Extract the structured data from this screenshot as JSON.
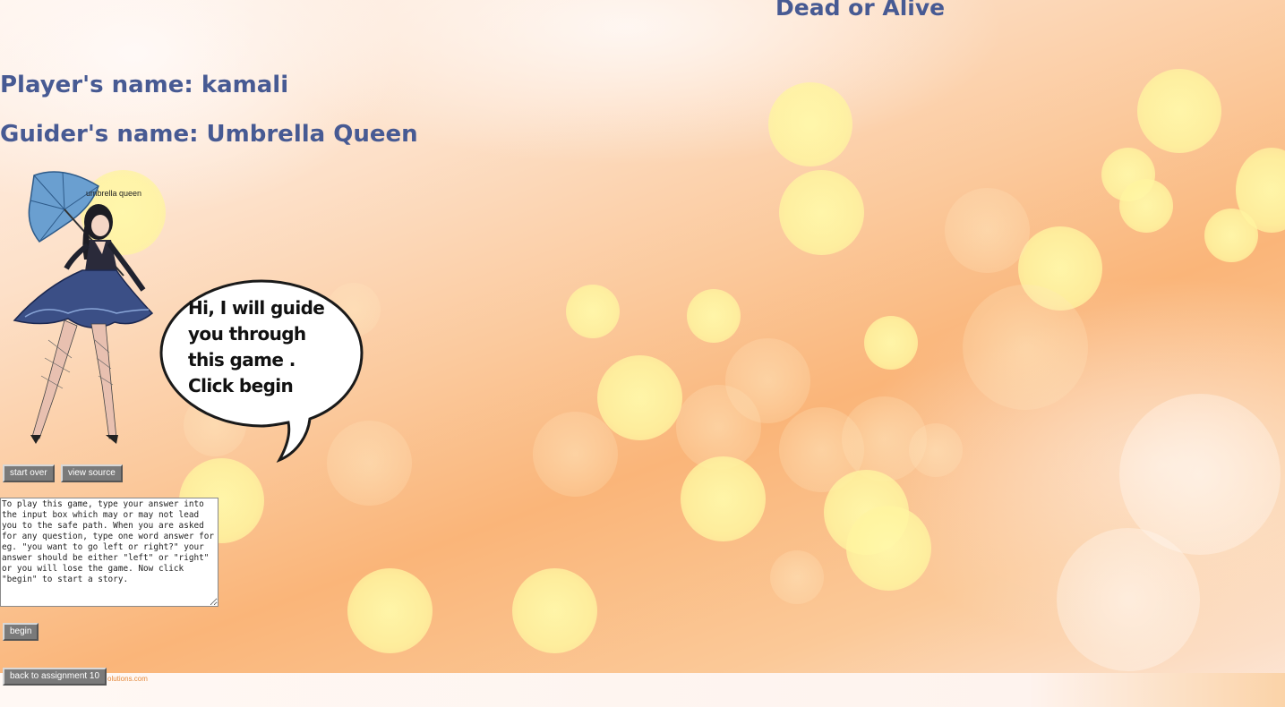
{
  "header": {
    "title": "Dead or Alive"
  },
  "player": {
    "label": "Player's name: kamali"
  },
  "guider": {
    "label": "Guider's name: Umbrella Queen",
    "caption": "umbrella queen",
    "speech": [
      "Hi, I will guide",
      "you through",
      "this game .",
      "Click begin"
    ]
  },
  "controls": {
    "start_over": "start over",
    "view_source": "view source",
    "begin": "begin",
    "back": "back to assignment 10"
  },
  "instructions": {
    "text": "To play this game, type your answer into the input box which may or may not lead you to the safe path. When you are asked for any question, type one word answer for eg. \"you want to go left or right?\" your answer should be either \"left\" or \"right\" or you will lose the game. Now click \"begin\" to start a story."
  },
  "footer": {
    "credit": "olutions.com"
  },
  "colors": {
    "heading": "#475a93",
    "button_bg": "#7a7a7a",
    "bokeh": "#fff5a0",
    "background_orange": "#fab579"
  },
  "icons": {
    "guide_character": "umbrella-queen-figure",
    "bubble": "speech-bubble"
  }
}
